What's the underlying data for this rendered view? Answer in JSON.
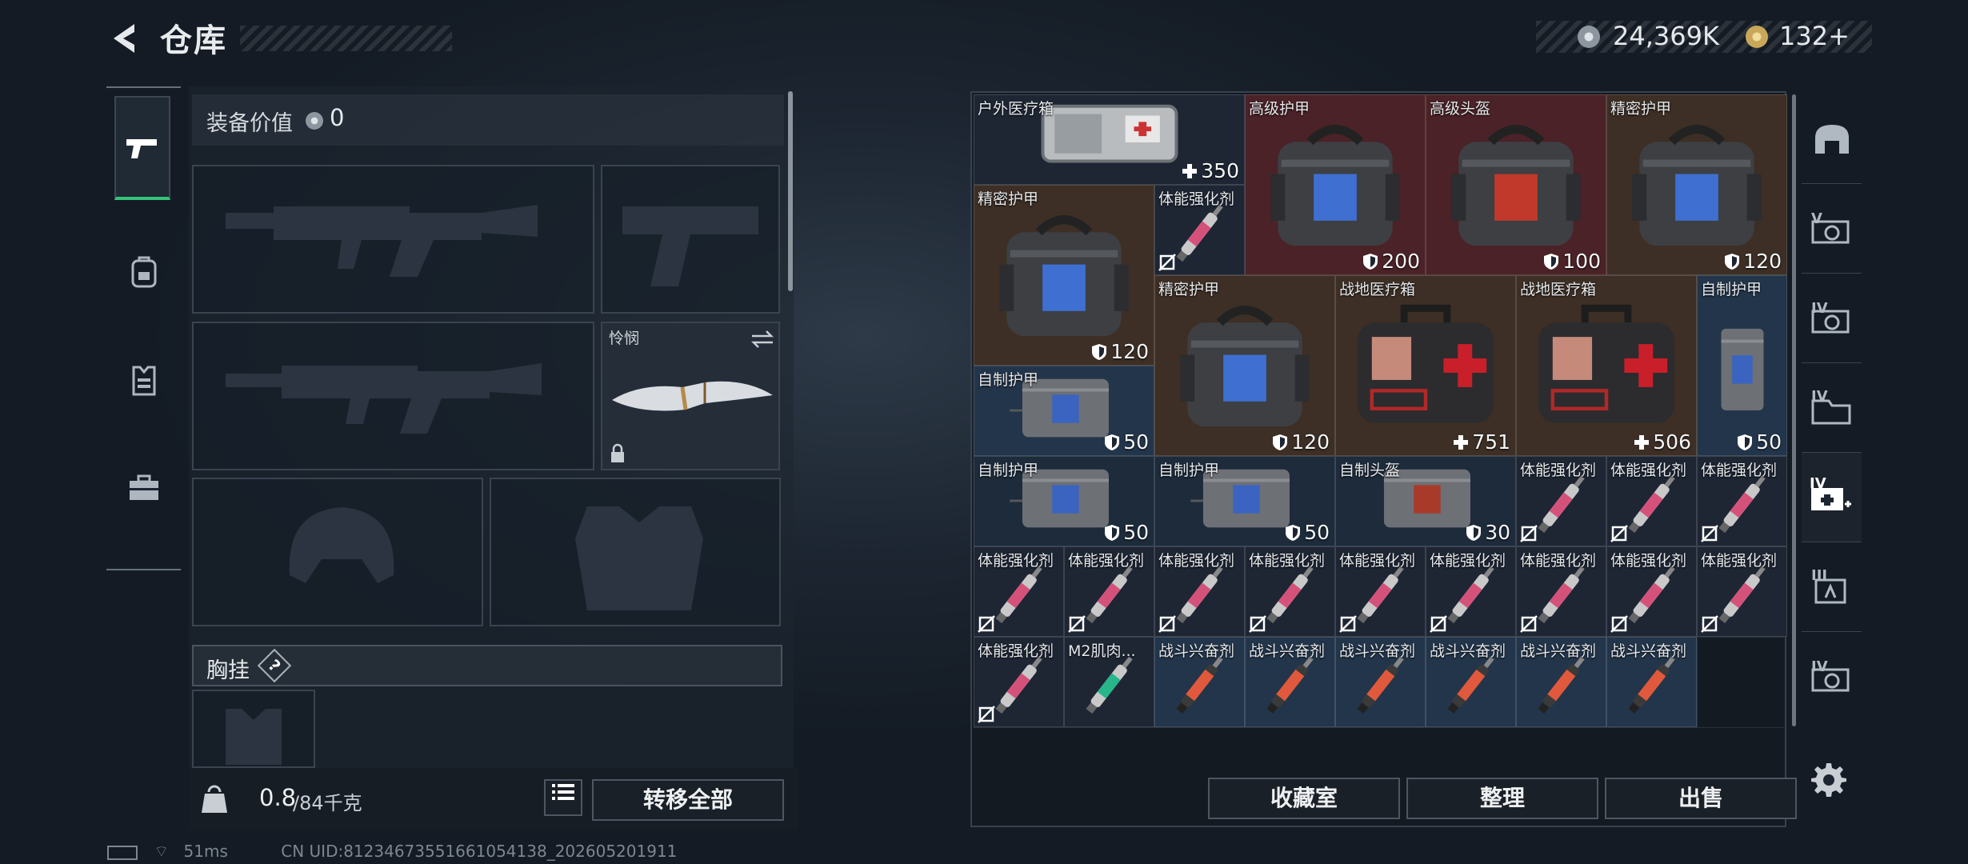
{
  "title": "仓库",
  "currency": {
    "silver": "24,369K",
    "gold": "132+",
    "silver_color": "#9aa3ad",
    "gold_color": "#c8a75a"
  },
  "left": {
    "value_label": "装备价值",
    "value": "0",
    "knife_label": "怜悯",
    "vest_label": "胸挂",
    "vest_help": "?",
    "weight": "0.8",
    "weight_unit": "/84千克",
    "transfer_all": "转移全部"
  },
  "nav": [
    "pistol-icon",
    "backpack-icon",
    "vest-icon",
    "toolbox-icon"
  ],
  "items": [
    {
      "name": "户外医疗箱",
      "value": "350",
      "kind": "heal",
      "art": "case-gray",
      "bg": "c-gray",
      "c": 0,
      "r": 0,
      "w": 3,
      "h": 1
    },
    {
      "name": "高级护甲",
      "value": "200",
      "kind": "armor",
      "art": "bag",
      "bg": "c-red",
      "c": 3,
      "r": 0,
      "w": 2,
      "h": 2
    },
    {
      "name": "高级头盔",
      "value": "100",
      "kind": "armor",
      "art": "bag-red",
      "bg": "c-red",
      "c": 5,
      "r": 0,
      "w": 2,
      "h": 2
    },
    {
      "name": "精密护甲",
      "value": "120",
      "kind": "armor",
      "art": "bag",
      "bg": "c-brown",
      "c": 7,
      "r": 0,
      "w": 2,
      "h": 2
    },
    {
      "name": "精密护甲",
      "value": "120",
      "kind": "armor",
      "art": "bag",
      "bg": "c-brown",
      "c": 0,
      "r": 1,
      "w": 2,
      "h": 2
    },
    {
      "name": "体能强化剂",
      "value": "",
      "kind": "nouse",
      "art": "syringe-pink",
      "bg": "c-gray",
      "c": 2,
      "r": 1,
      "w": 1,
      "h": 1
    },
    {
      "name": "精密护甲",
      "value": "120",
      "kind": "armor",
      "art": "bag",
      "bg": "c-brown",
      "c": 2,
      "r": 2,
      "w": 2,
      "h": 2
    },
    {
      "name": "战地医疗箱",
      "value": "751",
      "kind": "heal",
      "art": "firstaid",
      "bg": "c-brown",
      "c": 4,
      "r": 2,
      "w": 2,
      "h": 2
    },
    {
      "name": "战地医疗箱",
      "value": "506",
      "kind": "heal",
      "art": "firstaid",
      "bg": "c-brown",
      "c": 6,
      "r": 2,
      "w": 2,
      "h": 2
    },
    {
      "name": "自制护甲",
      "value": "50",
      "kind": "armor",
      "art": "vest-small",
      "bg": "c-steel",
      "c": 8,
      "r": 2,
      "w": 1,
      "h": 2
    },
    {
      "name": "自制护甲",
      "value": "50",
      "kind": "armor",
      "art": "vest-wide",
      "bg": "c-steel",
      "c": 0,
      "r": 3,
      "w": 2,
      "h": 1
    },
    {
      "name": "自制护甲",
      "value": "50",
      "kind": "armor",
      "art": "vest-wide",
      "bg": "c-blue",
      "c": 0,
      "r": 4,
      "w": 2,
      "h": 1
    },
    {
      "name": "自制护甲",
      "value": "50",
      "kind": "armor",
      "art": "vest-wide",
      "bg": "c-blue",
      "c": 2,
      "r": 4,
      "w": 2,
      "h": 1
    },
    {
      "name": "自制头盔",
      "value": "30",
      "kind": "armor",
      "art": "vest-red",
      "bg": "c-blue",
      "c": 4,
      "r": 4,
      "w": 2,
      "h": 1
    },
    {
      "name": "体能强化剂",
      "value": "",
      "kind": "nouse",
      "art": "syringe-pink",
      "bg": "c-gray",
      "c": 6,
      "r": 4,
      "w": 1,
      "h": 1
    },
    {
      "name": "体能强化剂",
      "value": "",
      "kind": "nouse",
      "art": "syringe-pink",
      "bg": "c-gray",
      "c": 7,
      "r": 4,
      "w": 1,
      "h": 1
    },
    {
      "name": "体能强化剂",
      "value": "",
      "kind": "nouse",
      "art": "syringe-pink",
      "bg": "c-gray",
      "c": 8,
      "r": 4,
      "w": 1,
      "h": 1
    },
    {
      "name": "体能强化剂",
      "value": "",
      "kind": "nouse",
      "art": "syringe-pink",
      "bg": "c-gray",
      "c": 0,
      "r": 5,
      "w": 1,
      "h": 1
    },
    {
      "name": "体能强化剂",
      "value": "",
      "kind": "nouse",
      "art": "syringe-pink",
      "bg": "c-gray",
      "c": 1,
      "r": 5,
      "w": 1,
      "h": 1
    },
    {
      "name": "体能强化剂",
      "value": "",
      "kind": "nouse",
      "art": "syringe-pink",
      "bg": "c-gray",
      "c": 2,
      "r": 5,
      "w": 1,
      "h": 1
    },
    {
      "name": "体能强化剂",
      "value": "",
      "kind": "nouse",
      "art": "syringe-pink",
      "bg": "c-gray",
      "c": 3,
      "r": 5,
      "w": 1,
      "h": 1
    },
    {
      "name": "体能强化剂",
      "value": "",
      "kind": "nouse",
      "art": "syringe-pink",
      "bg": "c-gray",
      "c": 4,
      "r": 5,
      "w": 1,
      "h": 1
    },
    {
      "name": "体能强化剂",
      "value": "",
      "kind": "nouse",
      "art": "syringe-pink",
      "bg": "c-gray",
      "c": 5,
      "r": 5,
      "w": 1,
      "h": 1
    },
    {
      "name": "体能强化剂",
      "value": "",
      "kind": "nouse",
      "art": "syringe-pink",
      "bg": "c-gray",
      "c": 6,
      "r": 5,
      "w": 1,
      "h": 1
    },
    {
      "name": "体能强化剂",
      "value": "",
      "kind": "nouse",
      "art": "syringe-pink",
      "bg": "c-gray",
      "c": 7,
      "r": 5,
      "w": 1,
      "h": 1
    },
    {
      "name": "体能强化剂",
      "value": "",
      "kind": "nouse",
      "art": "syringe-pink",
      "bg": "c-gray",
      "c": 8,
      "r": 5,
      "w": 1,
      "h": 1
    },
    {
      "name": "体能强化剂",
      "value": "",
      "kind": "nouse",
      "art": "syringe-pink",
      "bg": "c-gray",
      "c": 0,
      "r": 6,
      "w": 1,
      "h": 1
    },
    {
      "name": "M2肌肉...",
      "value": "",
      "kind": "none",
      "art": "syringe-green",
      "bg": "c-gray",
      "c": 1,
      "r": 6,
      "w": 1,
      "h": 1
    },
    {
      "name": "战斗兴奋剂",
      "value": "",
      "kind": "none",
      "art": "syringe-red",
      "bg": "c-steel",
      "c": 2,
      "r": 6,
      "w": 1,
      "h": 1
    },
    {
      "name": "战斗兴奋剂",
      "value": "",
      "kind": "none",
      "art": "syringe-red",
      "bg": "c-steel",
      "c": 3,
      "r": 6,
      "w": 1,
      "h": 1
    },
    {
      "name": "战斗兴奋剂",
      "value": "",
      "kind": "none",
      "art": "syringe-red",
      "bg": "c-steel",
      "c": 4,
      "r": 6,
      "w": 1,
      "h": 1
    },
    {
      "name": "战斗兴奋剂",
      "value": "",
      "kind": "none",
      "art": "syringe-red",
      "bg": "c-steel",
      "c": 5,
      "r": 6,
      "w": 1,
      "h": 1
    },
    {
      "name": "战斗兴奋剂",
      "value": "",
      "kind": "none",
      "art": "syringe-red",
      "bg": "c-steel",
      "c": 6,
      "r": 6,
      "w": 1,
      "h": 1
    },
    {
      "name": "战斗兴奋剂",
      "value": "",
      "kind": "none",
      "art": "syringe-red",
      "bg": "c-steel",
      "c": 7,
      "r": 6,
      "w": 1,
      "h": 1
    }
  ],
  "right_buttons": {
    "collection": "收藏室",
    "organize": "整理",
    "sell": "出售"
  },
  "right_nav": [
    "safe-icon",
    "v-gear-icon",
    "iv-gear-icon",
    "iv-folder-icon",
    "iv-medkit-icon",
    "iii-bag-icon",
    "iv-gear-icon-2"
  ],
  "right_nav_labels": [
    "V",
    "IV",
    "IV",
    "IV",
    "III",
    "IV"
  ],
  "status": {
    "ping": "51ms",
    "uid": "CN UID:81234673551661054138_202605201911"
  }
}
